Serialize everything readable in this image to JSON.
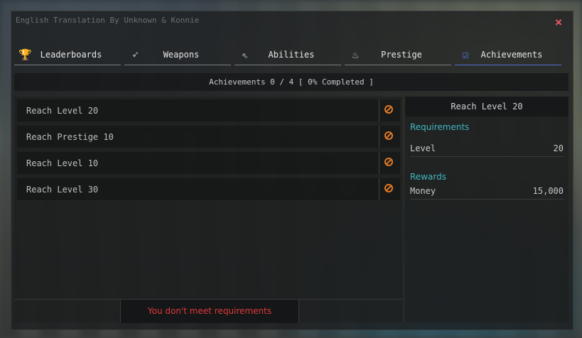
{
  "window": {
    "credit": "English Translation By Unknown & Konnie",
    "close_label": "×"
  },
  "tabs": [
    {
      "label": "Leaderboards",
      "icon": "trophy-icon",
      "glyph": "🏆",
      "active": false
    },
    {
      "label": "Weapons",
      "icon": "rocket-icon",
      "glyph": "➶",
      "active": false
    },
    {
      "label": "Abilities",
      "icon": "cursor-click-icon",
      "glyph": "⇖",
      "active": false
    },
    {
      "label": "Prestige",
      "icon": "flame-icon",
      "glyph": "♨",
      "active": false
    },
    {
      "label": "Achievements",
      "icon": "checklist-icon",
      "glyph": "☑",
      "active": true
    }
  ],
  "summary": "Achievements 0 / 4 [ 0% Completed ]",
  "achievements": [
    {
      "name": "Reach Level 20",
      "status_icon": "locked-icon"
    },
    {
      "name": "Reach Prestige 10",
      "status_icon": "locked-icon"
    },
    {
      "name": "Reach Level 10",
      "status_icon": "locked-icon"
    },
    {
      "name": "Reach Level 30",
      "status_icon": "locked-icon"
    }
  ],
  "status_message": "You don't meet requirements",
  "detail": {
    "title": "Reach Level 20",
    "requirements_label": "Requirements",
    "requirements": [
      {
        "key": "Level",
        "value": "20"
      }
    ],
    "rewards_label": "Rewards",
    "rewards": [
      {
        "key": "Money",
        "value": "15,000"
      }
    ]
  },
  "colors": {
    "accent_blue": "#4f6fd8",
    "section_cyan": "#3fb7c3",
    "status_orange": "#e07a26",
    "warning_red": "#e03a3a",
    "close_red": "#e05560"
  }
}
